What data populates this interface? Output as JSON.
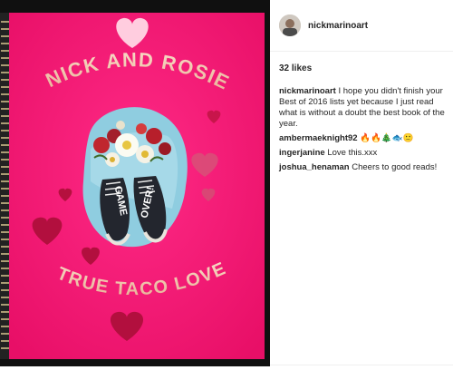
{
  "post": {
    "username": "nickmarinoart",
    "likes": "32 likes"
  },
  "photo": {
    "title": "NICK AND ROSIE",
    "subtitle": "TRUE TACO LOVE",
    "shoe_left": "GAME",
    "shoe_right": "OVER!"
  },
  "comments": [
    {
      "user": "nickmarinoart",
      "text": "I hope you didn't finish your Best of 2016 lists yet because I just read what is without a doubt the best book of the year."
    },
    {
      "user": "ambermaeknight92",
      "text": "🔥🔥🎄🐟🙂"
    },
    {
      "user": "ingerjanine",
      "text": "Love this.xxx"
    },
    {
      "user": "joshua_henaman",
      "text": "Cheers to good reads!"
    }
  ],
  "colors": {
    "cover": "#f2156f",
    "heart": "#c21346",
    "text": "#f3c9b5"
  }
}
